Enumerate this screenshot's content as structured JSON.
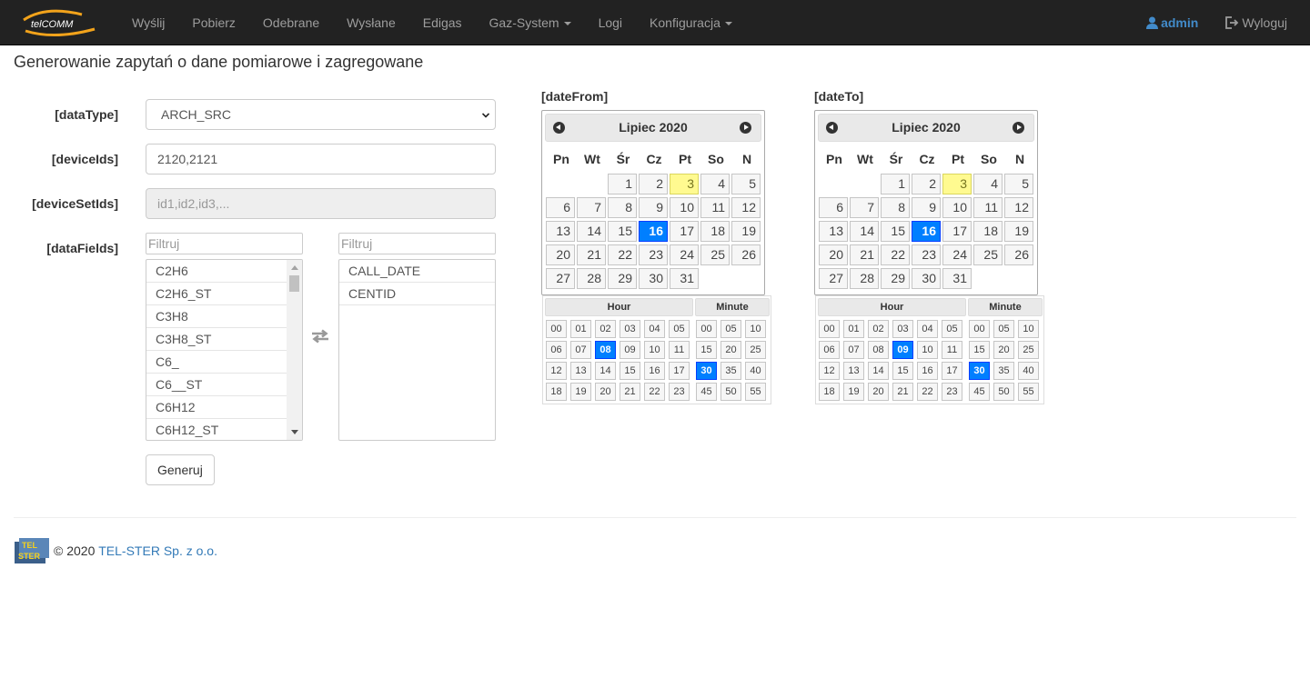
{
  "brand": {
    "logo_text": "telCOMM"
  },
  "nav": {
    "items": [
      "Wyślij",
      "Pobierz",
      "Odebrane",
      "Wysłane",
      "Edigas",
      "Gaz-System",
      "Logi",
      "Konfiguracja"
    ],
    "user": "admin",
    "logout": "Wyloguj"
  },
  "page": {
    "title": "Generowanie zapytań o dane pomiarowe i zagregowane"
  },
  "form": {
    "dataType": {
      "label": "[dataType]",
      "value": "ARCH_SRC"
    },
    "deviceIds": {
      "label": "[deviceIds]",
      "value": "2120,2121"
    },
    "deviceSetIds": {
      "label": "[deviceSetIds]",
      "placeholder": "id1,id2,id3,..."
    },
    "dataFields": {
      "label": "[dataFields]",
      "filter_placeholder": "Filtruj",
      "available": [
        "C2H6",
        "C2H6_ST",
        "C3H8",
        "C3H8_ST",
        "C6_",
        "C6__ST",
        "C6H12",
        "C6H12_ST"
      ],
      "selected": [
        "CALL_DATE",
        "CENTID"
      ]
    },
    "submit": "Generuj"
  },
  "calendars": {
    "from": {
      "label": "[dateFrom]",
      "month": "Lipiec 2020",
      "dow": [
        "Pn",
        "Wt",
        "Śr",
        "Cz",
        "Pt",
        "So",
        "N"
      ],
      "first_weekday": 2,
      "days_in_month": 31,
      "today": 3,
      "selected_day": 16,
      "time": {
        "hour_label": "Hour",
        "minute_label": "Minute",
        "hours": [
          "00",
          "01",
          "02",
          "03",
          "04",
          "05",
          "06",
          "07",
          "08",
          "09",
          "10",
          "11",
          "12",
          "13",
          "14",
          "15",
          "16",
          "17",
          "18",
          "19",
          "20",
          "21",
          "22",
          "23"
        ],
        "minutes": [
          "00",
          "05",
          "10",
          "15",
          "20",
          "25",
          "30",
          "35",
          "40",
          "45",
          "50",
          "55"
        ],
        "selected_hour": "08",
        "selected_minute": "30"
      }
    },
    "to": {
      "label": "[dateTo]",
      "month": "Lipiec 2020",
      "dow": [
        "Pn",
        "Wt",
        "Śr",
        "Cz",
        "Pt",
        "So",
        "N"
      ],
      "first_weekday": 2,
      "days_in_month": 31,
      "today": 3,
      "selected_day": 16,
      "time": {
        "hour_label": "Hour",
        "minute_label": "Minute",
        "hours": [
          "00",
          "01",
          "02",
          "03",
          "04",
          "05",
          "06",
          "07",
          "08",
          "09",
          "10",
          "11",
          "12",
          "13",
          "14",
          "15",
          "16",
          "17",
          "18",
          "19",
          "20",
          "21",
          "22",
          "23"
        ],
        "minutes": [
          "00",
          "05",
          "10",
          "15",
          "20",
          "25",
          "30",
          "35",
          "40",
          "45",
          "50",
          "55"
        ],
        "selected_hour": "09",
        "selected_minute": "30"
      }
    }
  },
  "footer": {
    "copyright": "© 2020",
    "company": "TEL-STER Sp. z o.o.",
    "logo_text": "TEL STER"
  },
  "colors": {
    "navbar": "#222222",
    "accent": "#007fff",
    "today": "#fffa90",
    "link": "#337ab7"
  }
}
